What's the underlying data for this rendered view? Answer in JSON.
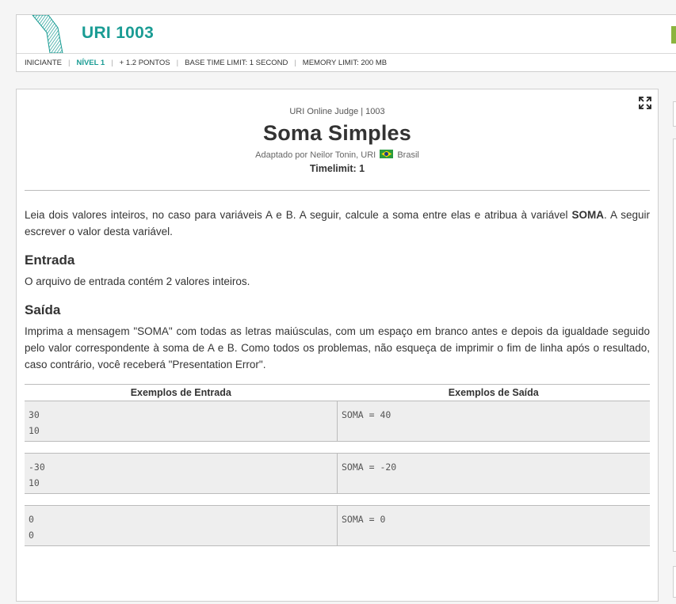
{
  "header": {
    "code": "URI 1003",
    "meta": {
      "category": "INICIANTE",
      "level": "NÍVEL 1",
      "points": "+ 1.2 PONTOS",
      "base_time": "BASE TIME LIMIT: 1 SECOND",
      "memory": "MEMORY LIMIT: 200 MB"
    }
  },
  "problem": {
    "judge": "URI Online Judge | 1003",
    "title": "Soma Simples",
    "author_prefix": "Adaptado por Neilor Tonin, URI",
    "country": "Brasil",
    "timelimit": "Timelimit: 1"
  },
  "description": {
    "part1": "Leia dois valores inteiros, no caso para variáveis A e B. A seguir, calcule a soma entre elas e atribua à variável ",
    "bold": "SOMA",
    "part2": ". A seguir escrever o valor desta variável."
  },
  "input_section": {
    "title": "Entrada",
    "text": "O arquivo de entrada contém 2 valores inteiros."
  },
  "output_section": {
    "title": "Saída",
    "text": "Imprima a mensagem \"SOMA\" com todas as letras maiúsculas, com um espaço em branco antes e depois da igualdade seguido pelo valor correspondente à soma de A e B. Como todos os problemas, não esqueça de imprimir o fim de linha após o resultado, caso contrário, você receberá \"Presentation Error\"."
  },
  "samples": {
    "input_header": "Exemplos de Entrada",
    "output_header": "Exemplos de Saída",
    "rows": [
      {
        "input": "30\n10",
        "output": "SOMA = 40"
      },
      {
        "input": "-30\n10",
        "output": "SOMA = -20"
      },
      {
        "input": "0\n0",
        "output": "SOMA = 0"
      }
    ]
  },
  "colors": {
    "brand": "#1a9c94",
    "accent_green": "#8bb43f"
  },
  "icons": [
    "expand-icon",
    "brazil-flag-icon",
    "uri-logo"
  ]
}
